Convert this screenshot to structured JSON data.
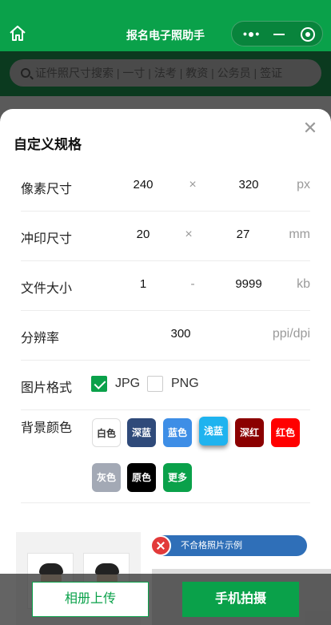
{
  "header": {
    "title": "报名电子照助手",
    "home_icon": "home-icon",
    "capsule": {
      "more_icon": "more-dots-icon",
      "minimize_icon": "minus-icon",
      "close_icon": "target-icon"
    },
    "bg_color": "#0aa14a"
  },
  "search": {
    "placeholder": "证件照尺寸搜索 | 一寸 | 法考 | 教资 | 公务员 | 签证",
    "icon": "search-icon"
  },
  "sheet": {
    "title": "自定义规格",
    "close_icon": "close-icon",
    "pixel_size": {
      "label": "像素尺寸",
      "width": "240",
      "sep": "×",
      "height": "320",
      "unit": "px"
    },
    "print_size": {
      "label": "冲印尺寸",
      "width": "20",
      "sep": "×",
      "height": "27",
      "unit": "mm"
    },
    "file_size": {
      "label": "文件大小",
      "min": "1",
      "sep": "-",
      "max": "9999",
      "unit": "kb"
    },
    "resolution": {
      "label": "分辨率",
      "value": "300",
      "unit": "ppi/dpi"
    },
    "format": {
      "label": "图片格式",
      "options": [
        {
          "label": "JPG",
          "checked": true
        },
        {
          "label": "PNG",
          "checked": false
        }
      ]
    },
    "background": {
      "label": "背景颜色",
      "colors": [
        {
          "label": "白色",
          "color": "#ffffff"
        },
        {
          "label": "深蓝",
          "color": "#2f4a7a"
        },
        {
          "label": "蓝色",
          "color": "#3e8ee6"
        },
        {
          "label": "浅蓝",
          "color": "#1fb3ef",
          "selected": true
        },
        {
          "label": "深红",
          "color": "#8b0000"
        },
        {
          "label": "红色",
          "color": "#ff0000"
        },
        {
          "label": "灰色",
          "color": "#a3a9b5"
        },
        {
          "label": "原色",
          "color": "#000000"
        },
        {
          "label": "更多",
          "color": "#0aa14a"
        }
      ]
    },
    "example": {
      "bad_label": "不合格照片示例",
      "bad_icon": "error-x-icon"
    }
  },
  "actions": {
    "album_label": "相册上传",
    "camera_label": "手机拍摄",
    "accent": "#0aa14a"
  }
}
